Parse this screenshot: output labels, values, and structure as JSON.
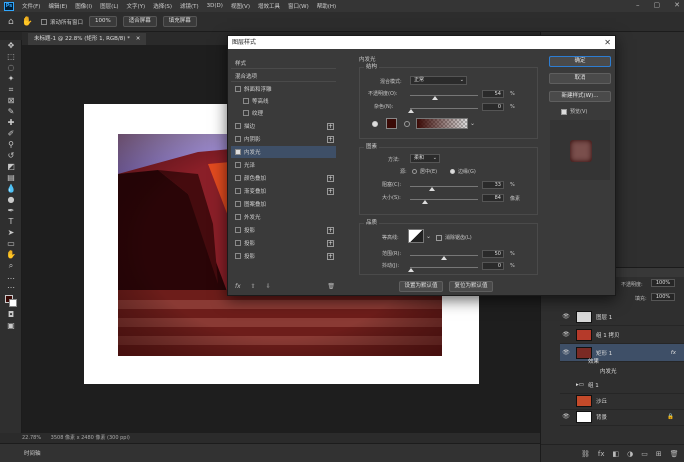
{
  "app": {
    "logo": "Ps",
    "menu": [
      "文件(F)",
      "编辑(E)",
      "图像(I)",
      "图层(L)",
      "文字(Y)",
      "选择(S)",
      "滤镜(T)",
      "3D(D)",
      "视图(V)",
      "增效工具",
      "窗口(W)",
      "帮助(H)"
    ]
  },
  "options": {
    "scroll_all": "滚动所有窗口",
    "zoom": "100%",
    "fit_screen": "适合屏幕",
    "fill_screen": "填充屏幕"
  },
  "document": {
    "tab_title": "未标题-1 @ 22.8% (矩形 1, RGB/8) *",
    "status_zoom": "22.78%",
    "status_info": "3508 像素 x 2480 像素 (300 ppi)",
    "timeline_label": "时间轴"
  },
  "dialog": {
    "title": "图层样式",
    "styles_header": "样式",
    "blend_options": "混合选项",
    "items": [
      {
        "label": "斜面和浮雕",
        "checked": false,
        "plus": false
      },
      {
        "label": "等高线",
        "checked": false,
        "plus": false
      },
      {
        "label": "纹理",
        "checked": false,
        "plus": false
      },
      {
        "label": "描边",
        "checked": false,
        "plus": true
      },
      {
        "label": "内阴影",
        "checked": false,
        "plus": true
      },
      {
        "label": "内发光",
        "checked": true,
        "plus": false
      },
      {
        "label": "光泽",
        "checked": false,
        "plus": false
      },
      {
        "label": "颜色叠加",
        "checked": false,
        "plus": true
      },
      {
        "label": "渐变叠加",
        "checked": false,
        "plus": true
      },
      {
        "label": "图案叠加",
        "checked": false,
        "plus": false
      },
      {
        "label": "外发光",
        "checked": false,
        "plus": false
      },
      {
        "label": "投影",
        "checked": false,
        "plus": true
      },
      {
        "label": "投影",
        "checked": false,
        "plus": true
      },
      {
        "label": "投影",
        "checked": false,
        "plus": true
      }
    ],
    "fx_label": "fx",
    "section_title": "内发光",
    "structure": {
      "title": "结构",
      "blend_mode_label": "混合模式:",
      "blend_mode": "正常",
      "opacity_label": "不透明度(O):",
      "opacity": "54",
      "noise_label": "杂色(N):",
      "noise": "0",
      "pct": "%",
      "glow_color": "#3a0a06"
    },
    "elements": {
      "title": "图素",
      "method_label": "方法:",
      "method": "柔和",
      "source_label": "源:",
      "source_center": "居中(E)",
      "source_edge": "边缘(G)",
      "choke_label": "阻塞(C):",
      "choke": "33",
      "size_label": "大小(S):",
      "size": "84",
      "px": "像素"
    },
    "quality": {
      "title": "品质",
      "contour_label": "等高线:",
      "antialias": "消除锯齿(L)",
      "range_label": "范围(R):",
      "range": "50",
      "jitter_label": "抖动(J):",
      "jitter": "0"
    },
    "set_default": "设置为默认值",
    "reset_default": "复位为默认值",
    "ok": "确定",
    "cancel": "取消",
    "new_style": "新建样式(W)...",
    "preview": "预览(V)"
  },
  "layers": {
    "opacity_label": "不透明度:",
    "opacity": "100%",
    "fill_label": "填充:",
    "fill": "100%",
    "rows": [
      {
        "name": "图层 1",
        "kind": "layer",
        "selected": false,
        "thumb": "#d8d8d8"
      },
      {
        "name": "组 1 拷贝",
        "kind": "group",
        "selected": false,
        "thumb": "#b53a2a"
      },
      {
        "name": "矩形 1",
        "kind": "layer",
        "selected": true,
        "thumb": "#7a2a24"
      },
      {
        "name": "效果",
        "kind": "sub",
        "selected": false,
        "thumb": ""
      },
      {
        "name": "内发光",
        "kind": "sub",
        "selected": false,
        "thumb": ""
      },
      {
        "name": "组 1",
        "kind": "group",
        "selected": false,
        "thumb": ""
      },
      {
        "name": "沙丘",
        "kind": "layer",
        "selected": false,
        "thumb": "#c44a2a"
      },
      {
        "name": "背景",
        "kind": "layer",
        "selected": false,
        "thumb": "#ffffff"
      }
    ]
  }
}
